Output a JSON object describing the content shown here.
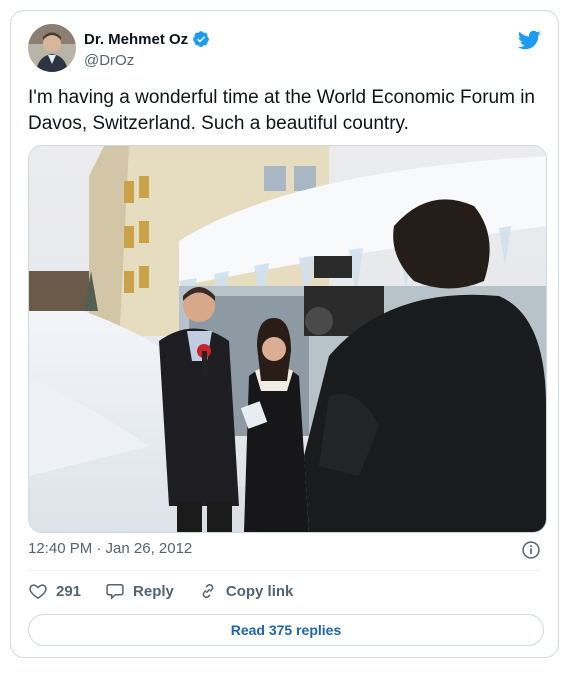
{
  "author": {
    "name": "Dr. Mehmet Oz",
    "handle": "@DrOz",
    "verified": true
  },
  "tweet": {
    "text": "I'm having a wonderful time at the World Economic Forum in Davos, Switzerland. Such a beautiful country.",
    "timestamp": "12:40 PM · Jan 26, 2012"
  },
  "actions": {
    "like_count": "291",
    "reply_label": "Reply",
    "copy_link_label": "Copy link"
  },
  "read_replies_label": "Read 375 replies",
  "icons": {
    "brand": "twitter-bird-icon",
    "verified": "verified-badge-icon",
    "info": "info-icon",
    "like": "heart-icon",
    "reply": "speech-bubble-icon",
    "copy": "link-icon"
  },
  "colors": {
    "twitter_blue": "#1d9bf0",
    "link_blue": "#1d64ab",
    "text": "#0f1419",
    "secondary": "#536471",
    "border": "#cfd9de"
  }
}
